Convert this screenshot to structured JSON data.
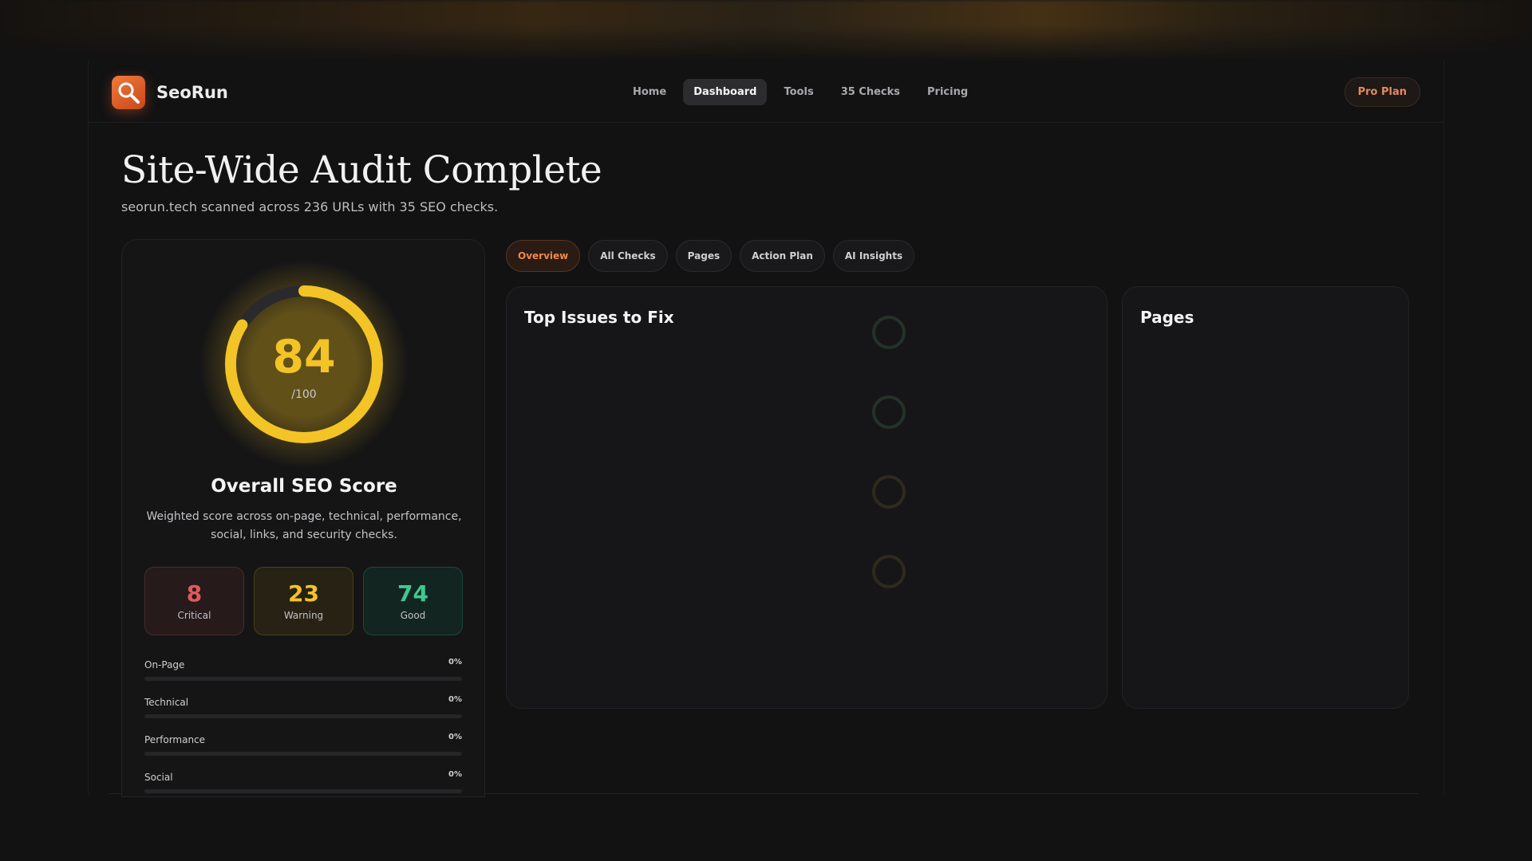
{
  "app": {
    "brand": "SeoRun",
    "nav": [
      {
        "label": "Home",
        "active": false
      },
      {
        "label": "Dashboard",
        "active": true
      },
      {
        "label": "Tools",
        "active": false
      },
      {
        "label": "35 Checks",
        "active": false
      },
      {
        "label": "Pricing",
        "active": false
      }
    ],
    "plan_button": "Pro Plan"
  },
  "header": {
    "title": "Site-Wide Audit Complete",
    "subtitle": "seorun.tech scanned across 236 URLs with 35 SEO checks."
  },
  "score": {
    "value": "84",
    "max": "/100",
    "fraction": 0.84,
    "title": "Overall SEO Score",
    "description": "Weighted score across on-page, technical, performance, social, links, and security checks.",
    "counts": [
      {
        "num": "8",
        "label": "Critical"
      },
      {
        "num": "23",
        "label": "Warning"
      },
      {
        "num": "74",
        "label": "Good"
      }
    ],
    "categories": [
      {
        "name": "On-Page",
        "pct": "0%",
        "fill": 0
      },
      {
        "name": "Technical",
        "pct": "0%",
        "fill": 0
      },
      {
        "name": "Performance",
        "pct": "0%",
        "fill": 0
      },
      {
        "name": "Social",
        "pct": "0%",
        "fill": 0
      }
    ]
  },
  "tabs": [
    {
      "label": "Overview",
      "active": true
    },
    {
      "label": "All Checks",
      "active": false
    },
    {
      "label": "Pages",
      "active": false
    },
    {
      "label": "Action Plan",
      "active": false
    },
    {
      "label": "AI Insights",
      "active": false
    }
  ],
  "issues_panel": {
    "title": "Top Issues to Fix"
  },
  "pages_panel": {
    "title": "Pages"
  },
  "colors": {
    "accent": "#f1884b",
    "score": "#f3c425",
    "critical": "#e05a5a",
    "good": "#3dc990"
  }
}
